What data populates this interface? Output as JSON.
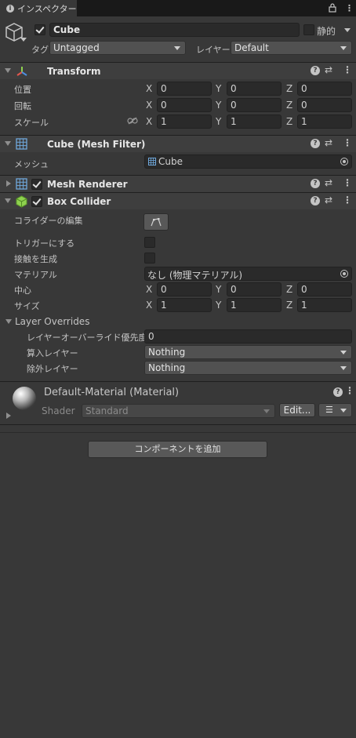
{
  "tab": {
    "title": "インスペクター",
    "icon": "info-icon"
  },
  "object": {
    "name": "Cube",
    "active": true,
    "static_label": "静的",
    "static_checked": false,
    "tag_label": "タグ",
    "tag_value": "Untagged",
    "layer_label": "レイヤー",
    "layer_value": "Default"
  },
  "transform": {
    "title": "Transform",
    "position_label": "位置",
    "rotation_label": "回転",
    "scale_label": "スケール",
    "axes": [
      "X",
      "Y",
      "Z"
    ],
    "position": [
      "0",
      "0",
      "0"
    ],
    "rotation": [
      "0",
      "0",
      "0"
    ],
    "scale": [
      "1",
      "1",
      "1"
    ]
  },
  "mesh_filter": {
    "title": "Cube (Mesh Filter)",
    "mesh_label": "メッシュ",
    "mesh_value": "Cube"
  },
  "mesh_renderer": {
    "title": "Mesh Renderer",
    "enabled": true
  },
  "box_collider": {
    "title": "Box Collider",
    "enabled": true,
    "edit_label": "コライダーの編集",
    "trigger_label": "トリガーにする",
    "contacts_label": "接触を生成",
    "material_label": "マテリアル",
    "material_value": "なし (物理マテリアル)",
    "center_label": "中心",
    "size_label": "サイズ",
    "center": [
      "0",
      "0",
      "0"
    ],
    "size": [
      "1",
      "1",
      "1"
    ],
    "layer_overrides_label": "Layer Overrides",
    "priority_label": "レイヤーオーバーライド優先度",
    "priority_value": "0",
    "include_label": "算入レイヤー",
    "include_value": "Nothing",
    "exclude_label": "除外レイヤー",
    "exclude_value": "Nothing"
  },
  "material": {
    "title": "Default-Material (Material)",
    "shader_label": "Shader",
    "shader_value": "Standard",
    "edit_button": "Edit..."
  },
  "add_component_button": "コンポーネントを追加",
  "colors": {
    "background": "#383838",
    "header": "#3e3e3e",
    "field": "#2a2a2a",
    "transform_icon_red": "#e4574e",
    "transform_icon_green": "#8fd14f",
    "transform_icon_blue": "#4d8fe0",
    "mesh_icon": "#6fa8dc",
    "collider_icon": "#8fd14f"
  }
}
